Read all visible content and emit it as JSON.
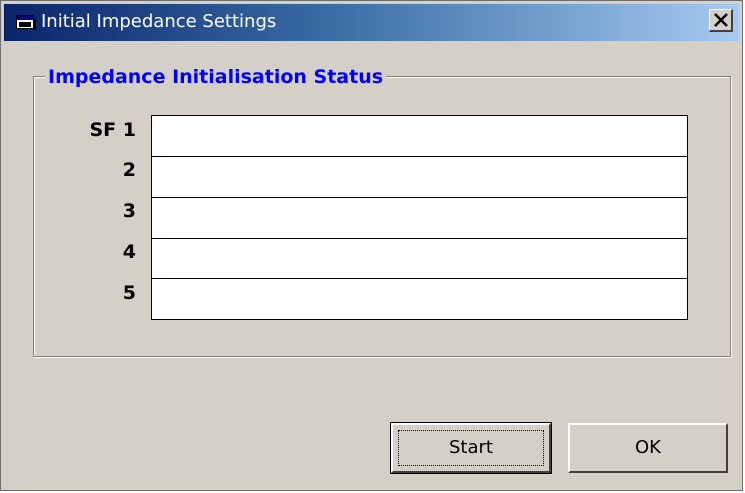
{
  "window": {
    "title": "Initial Impedance Settings",
    "close_glyph": "X"
  },
  "group": {
    "title": "Impedance Initialisation Status",
    "rows": [
      {
        "label": "SF 1",
        "value": ""
      },
      {
        "label": "2",
        "value": ""
      },
      {
        "label": "3",
        "value": ""
      },
      {
        "label": "4",
        "value": ""
      },
      {
        "label": "5",
        "value": ""
      }
    ]
  },
  "buttons": {
    "start_label": "Start",
    "ok_label": "OK"
  },
  "colors": {
    "title_gradient_start": "#0a246a",
    "title_gradient_end": "#a6caf0",
    "group_title": "#0000ff",
    "face": "#d4d0c8"
  },
  "icons": {
    "app": "app-window-icon",
    "close": "close-icon"
  }
}
